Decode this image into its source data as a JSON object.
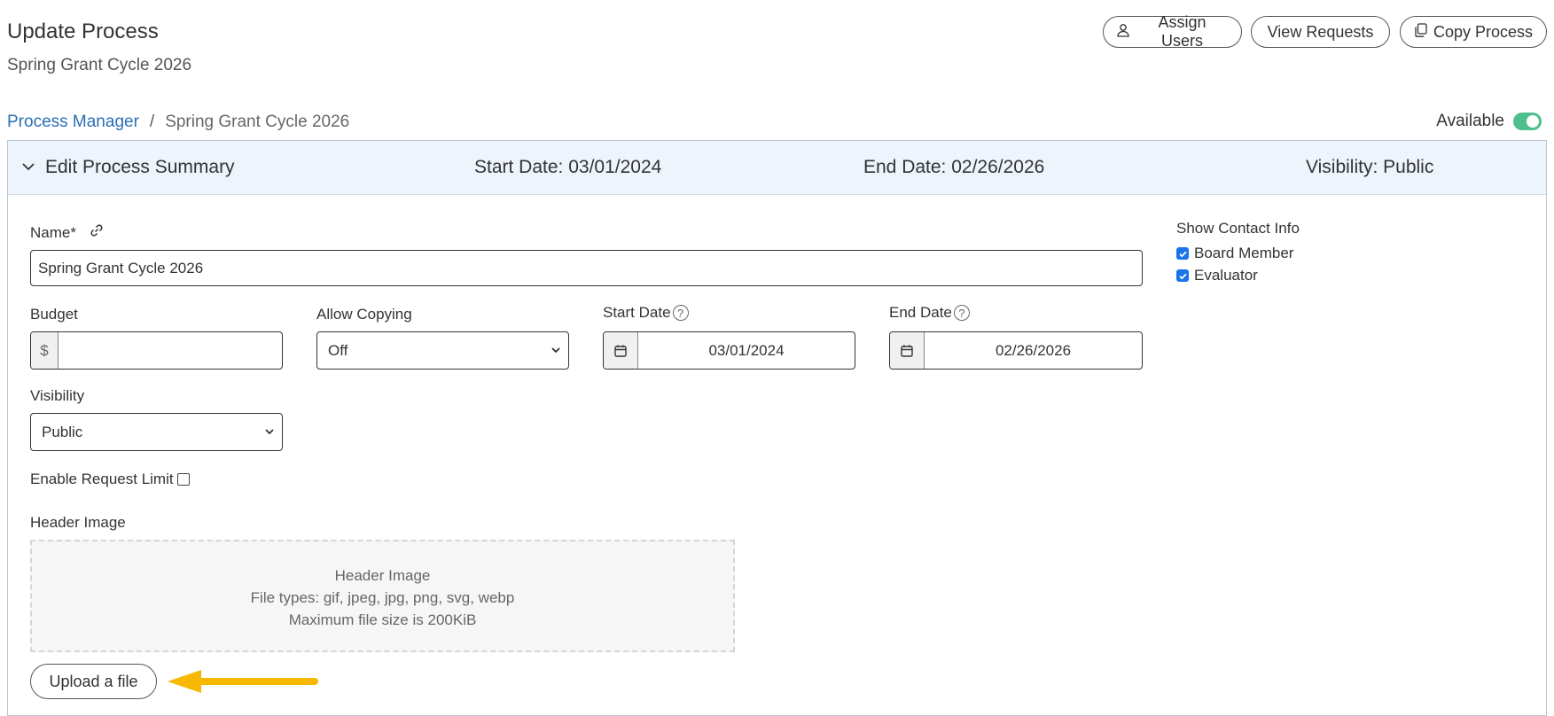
{
  "header": {
    "title": "Update Process",
    "subtitle": "Spring Grant Cycle 2026",
    "buttons": {
      "assign_users": "Assign Users",
      "view_requests": "View Requests",
      "copy_process": "Copy Process"
    }
  },
  "breadcrumb": {
    "root": "Process Manager",
    "separator": "/",
    "current": "Spring Grant Cycle 2026"
  },
  "availability": {
    "label": "Available",
    "enabled": true
  },
  "summary": {
    "title": "Edit Process Summary",
    "start_date": "Start Date: 03/01/2024",
    "end_date": "End Date: 02/26/2026",
    "visibility": "Visibility: Public"
  },
  "form": {
    "name_label": "Name*",
    "name_value": "Spring Grant Cycle 2026",
    "budget_label": "Budget",
    "budget_prefix": "$",
    "budget_value": "",
    "allow_copying_label": "Allow Copying",
    "allow_copying_value": "Off",
    "start_date_label": "Start Date",
    "start_date_value": "03/01/2024",
    "end_date_label": "End Date",
    "end_date_value": "02/26/2026",
    "visibility_label": "Visibility",
    "visibility_value": "Public",
    "request_limit_label": "Enable Request Limit",
    "request_limit_checked": false,
    "header_image_label": "Header Image",
    "dropzone": {
      "title": "Header Image",
      "file_types": "File types: gif, jpeg, jpg, png, svg, webp",
      "max_size": "Maximum file size is 200KiB"
    },
    "upload_label": "Upload a file"
  },
  "contact_info": {
    "title": "Show Contact Info",
    "options": [
      {
        "label": "Board Member",
        "checked": true
      },
      {
        "label": "Evaluator",
        "checked": true
      }
    ]
  },
  "colors": {
    "link": "#2a6fb5",
    "toggle_on": "#4fc08d",
    "checkbox": "#1a73e8",
    "arrow": "#f6b800",
    "header_bg": "#edf4fc"
  }
}
